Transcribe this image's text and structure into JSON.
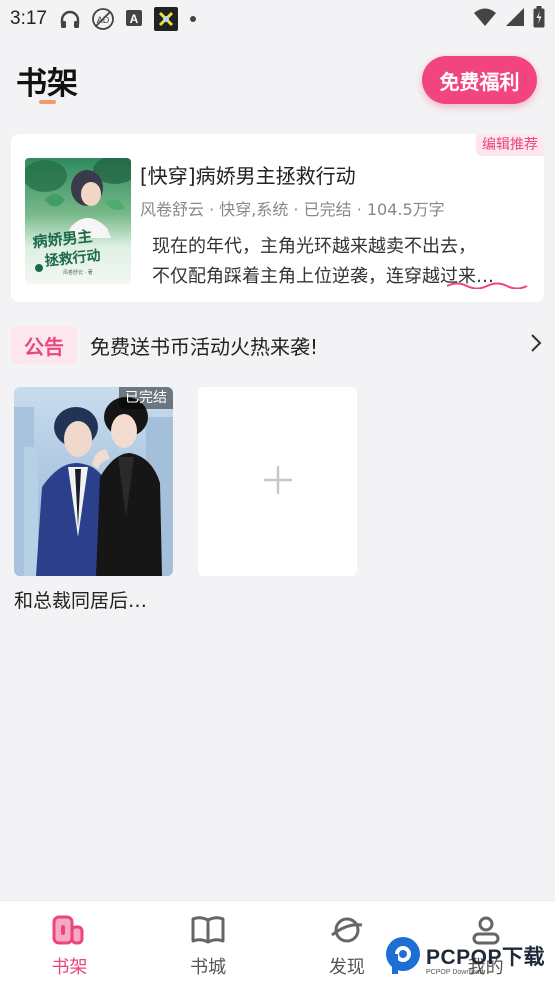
{
  "status_bar": {
    "time": "3:17",
    "icons_left": [
      "headphones-icon",
      "no-ad-icon",
      "a-notification-icon",
      "app-notification-icon",
      "dot-icon"
    ],
    "icons_right": [
      "wifi-icon",
      "signal-icon",
      "battery-icon"
    ]
  },
  "header": {
    "title": "书架",
    "free_button": "免费福利"
  },
  "recommend": {
    "badge": "编辑推荐",
    "title": "[快穿]病娇男主拯救行动",
    "meta": "风卷舒云 · 快穿,系统 · 已完结 · 104.5万字",
    "desc_line1": "现在的年代，主角光环越来越卖不出去，",
    "desc_line2": "不仅配角踩着主角上位逆袭，连穿越过来…",
    "cover_text": "病娇男主拯救行动",
    "cover_author": "风卷舒云 · 著"
  },
  "notice": {
    "tag": "公告",
    "text": "免费送书币活动火热来袭!"
  },
  "shelf": {
    "books": [
      {
        "title": "和总裁同居后…",
        "badge": "已完结"
      }
    ]
  },
  "bottom_nav": {
    "items": [
      {
        "label": "书架",
        "icon": "bookshelf-icon",
        "active": true
      },
      {
        "label": "书城",
        "icon": "book-open-icon",
        "active": false
      },
      {
        "label": "发现",
        "icon": "planet-icon",
        "active": false
      },
      {
        "label": "我的",
        "icon": "person-icon",
        "active": false
      }
    ]
  },
  "watermark": {
    "brand": "PCPOP下载",
    "sub": "PCPOP Download"
  },
  "colors": {
    "accent": "#f2447d",
    "accent_light": "#fde6ee",
    "background": "#f3f3f5"
  }
}
